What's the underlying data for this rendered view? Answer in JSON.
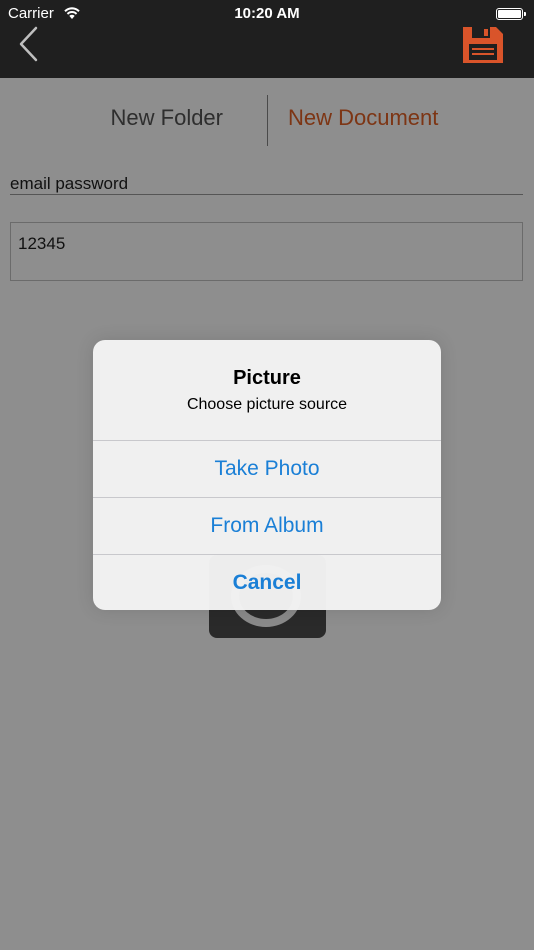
{
  "status_bar": {
    "carrier": "Carrier",
    "time": "10:20 AM"
  },
  "nav": {
    "back_icon": "chevron-left-icon",
    "save_icon": "floppy-disk-icon",
    "accent_color": "#d9542a"
  },
  "segment": {
    "items": [
      {
        "label": "New Folder",
        "selected": false
      },
      {
        "label": "New Document",
        "selected": true
      }
    ]
  },
  "form": {
    "title_value": "email password",
    "body_value": "12345"
  },
  "alert": {
    "title": "Picture",
    "message": "Choose picture source",
    "buttons": {
      "take_photo": "Take Photo",
      "from_album": "From Album",
      "cancel": "Cancel"
    },
    "button_color": "#1a7fd6"
  },
  "background": {
    "camera_icon": "camera-icon"
  }
}
